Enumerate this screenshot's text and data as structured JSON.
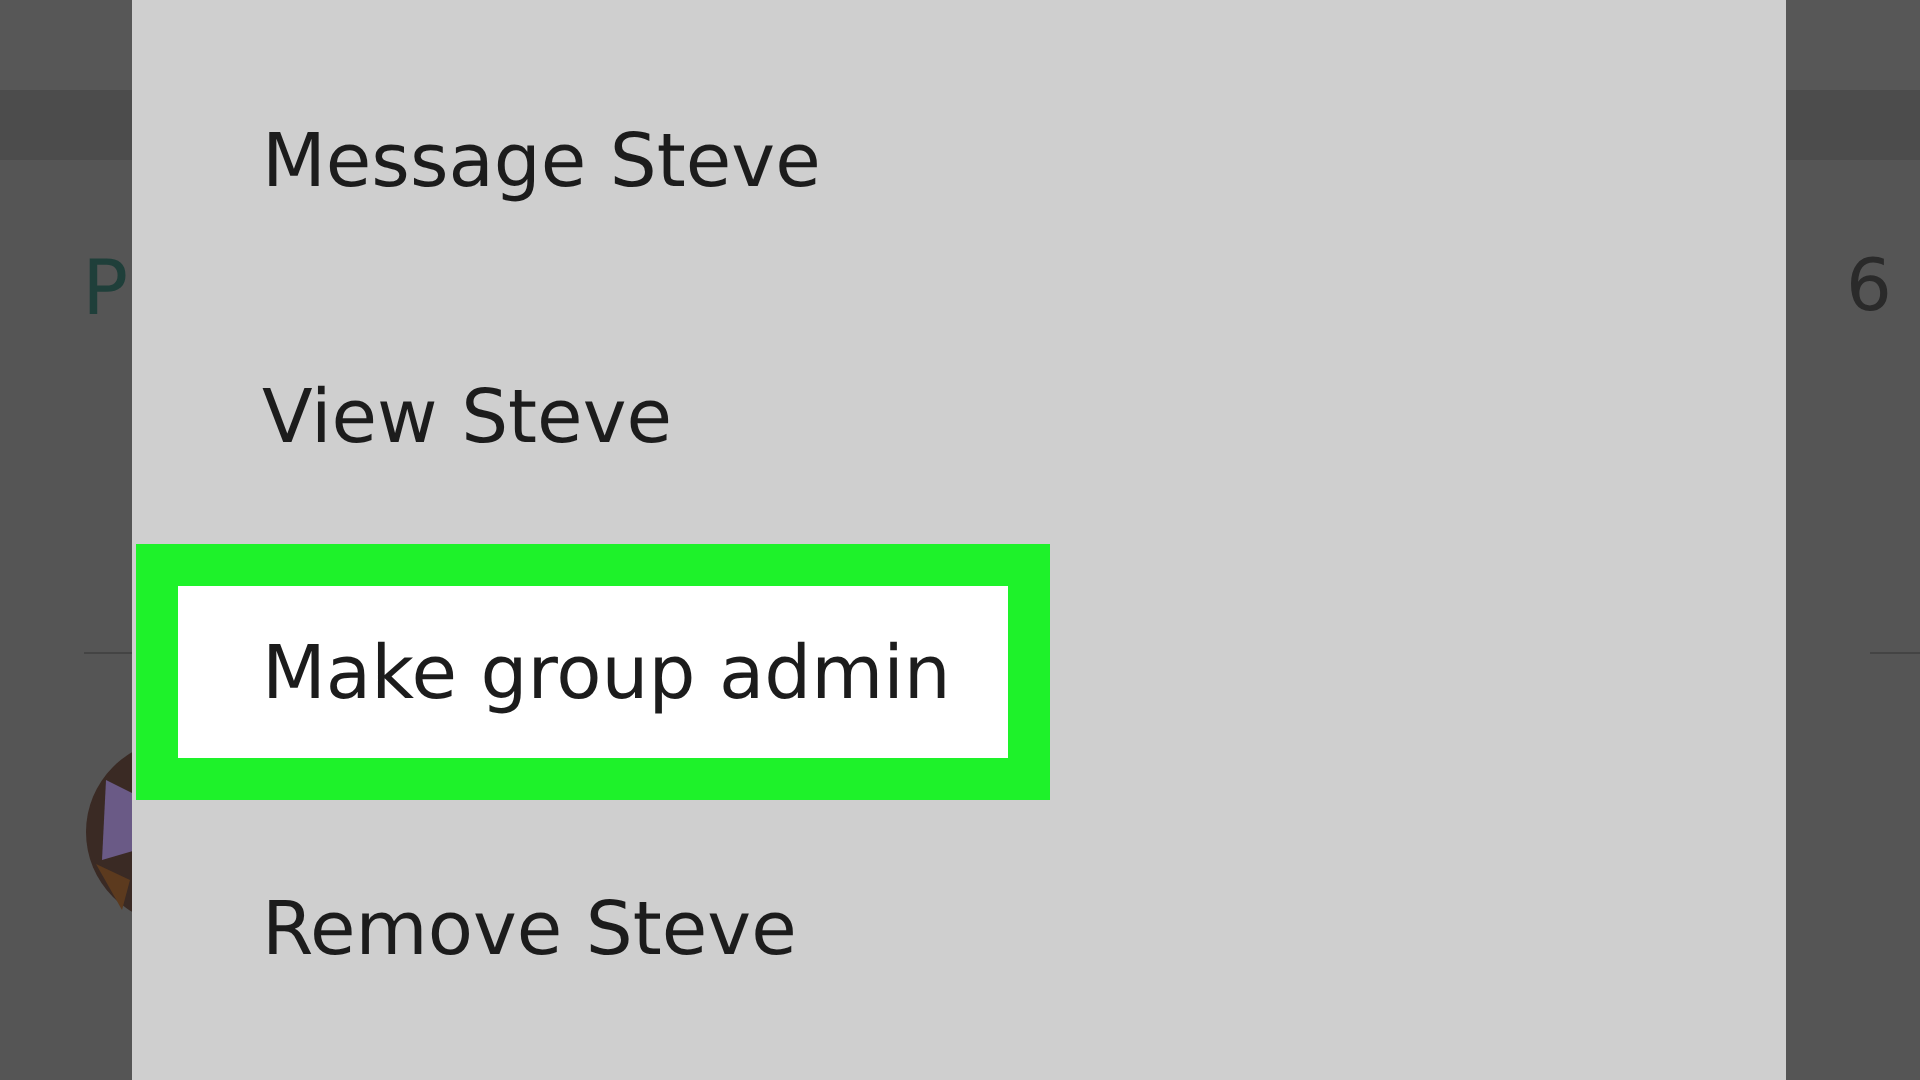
{
  "background": {
    "section_heading": "P",
    "count": "6"
  },
  "menu": {
    "items": [
      {
        "label": "Message Steve",
        "selected": false
      },
      {
        "label": "View Steve",
        "selected": false
      },
      {
        "label": "Make group admin",
        "selected": true
      },
      {
        "label": "Remove Steve",
        "selected": false
      }
    ]
  }
}
